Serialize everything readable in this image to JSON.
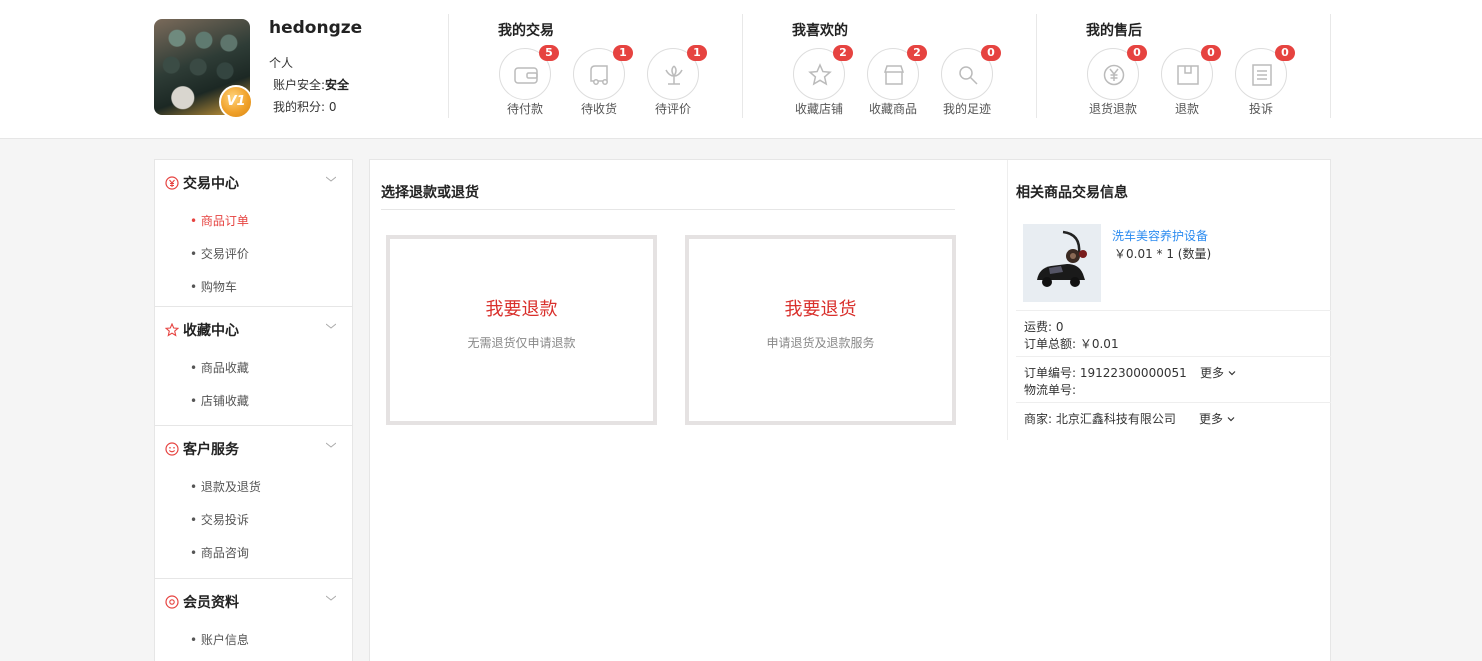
{
  "user": {
    "name": "hedongze",
    "type": "个人",
    "security_label": "账户安全:",
    "security_value": "安全",
    "points": "我的积分: 0",
    "vip_level": "V1"
  },
  "groups": [
    {
      "title": "我的交易",
      "items": [
        {
          "label": "待付款",
          "count": "5",
          "icon": "wallet-icon"
        },
        {
          "label": "待收货",
          "count": "1",
          "icon": "truck-icon"
        },
        {
          "label": "待评价",
          "count": "1",
          "icon": "flower-icon"
        }
      ]
    },
    {
      "title": "我喜欢的",
      "items": [
        {
          "label": "收藏店铺",
          "count": "2",
          "icon": "star-icon"
        },
        {
          "label": "收藏商品",
          "count": "2",
          "icon": "store-icon"
        },
        {
          "label": "我的足迹",
          "count": "0",
          "icon": "footprint-icon"
        }
      ]
    },
    {
      "title": "我的售后",
      "items": [
        {
          "label": "退货退款",
          "count": "0",
          "icon": "yuan-icon"
        },
        {
          "label": "退款",
          "count": "0",
          "icon": "box-icon"
        },
        {
          "label": "投诉",
          "count": "0",
          "icon": "document-icon"
        }
      ]
    }
  ],
  "sidebar": {
    "sections": [
      {
        "title": "交易中心",
        "icon": "transaction-icon",
        "items": [
          "• 商品订单",
          "• 交易评价",
          "• 购物车"
        ]
      },
      {
        "title": "收藏中心",
        "icon": "star-outline-icon",
        "items": [
          "• 商品收藏",
          "• 店铺收藏"
        ]
      },
      {
        "title": "客户服务",
        "icon": "smile-icon",
        "items": [
          "• 退款及退货",
          "• 交易投诉",
          "• 商品咨询"
        ]
      },
      {
        "title": "会员资料",
        "icon": "member-icon",
        "items": [
          "• 账户信息"
        ]
      }
    ]
  },
  "main": {
    "title": "选择退款或退货",
    "refund": {
      "title": "我要退款",
      "subtitle": "无需退货仅申请退款"
    },
    "return": {
      "title": "我要退货",
      "subtitle": "申请退货及退款服务"
    }
  },
  "related": {
    "title": "相关商品交易信息",
    "product_name": "洗车美容养护设备",
    "product_price": "￥0.01 * 1 (数量)",
    "shipping": "运费: 0",
    "total": "订单总额: ￥0.01",
    "order_no": "订单编号: 19122300000051",
    "logistics_no": "物流单号:",
    "merchant": "商家: 北京汇鑫科技有限公司",
    "more1": "更多",
    "more2": "更多"
  },
  "colors": {
    "accent_red": "#e64340",
    "link_blue": "#2d8cf0"
  }
}
